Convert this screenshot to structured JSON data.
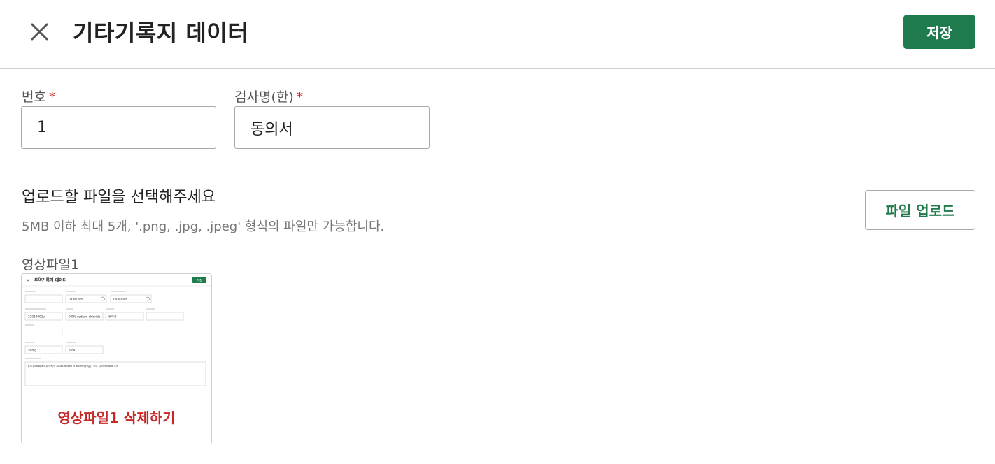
{
  "header": {
    "title": "기타기록지 데이터",
    "save_label": "저장",
    "close_icon": "close-icon"
  },
  "form": {
    "number": {
      "label": "번호",
      "required_mark": "*",
      "value": "1"
    },
    "exam_name": {
      "label": "검사명(한)",
      "required_mark": "*",
      "value": "동의서"
    }
  },
  "upload": {
    "title": "업로드할 파일을 선택해주세요",
    "hint": "5MB 이하 최대 5개, '.png, .jpg, .jpeg' 형식의 파일만 가능합니다.",
    "button_label": "파일 업로드"
  },
  "files": [
    {
      "label": "영상파일1",
      "delete_label": "영상파일1 삭제하기",
      "thumbnail": {
        "title": "투약기록지 데이터",
        "save_label": "저장",
        "row1": [
          "1",
          "09:00 am",
          "09:00 am"
        ],
        "row2": [
          "22019002u",
          "0.9% sodium chloride",
          "투약자"
        ],
        "row3": [
          "50mg",
          "IB8a"
        ],
        "note": "p.o.(Nasogen 1g+N/S 100cc mixed IV slowly(10분)) 투여 시 herbfood 주의"
      }
    }
  ],
  "colors": {
    "primary": "#1f7a4d",
    "danger": "#c62828",
    "border": "#a8a8a8"
  }
}
